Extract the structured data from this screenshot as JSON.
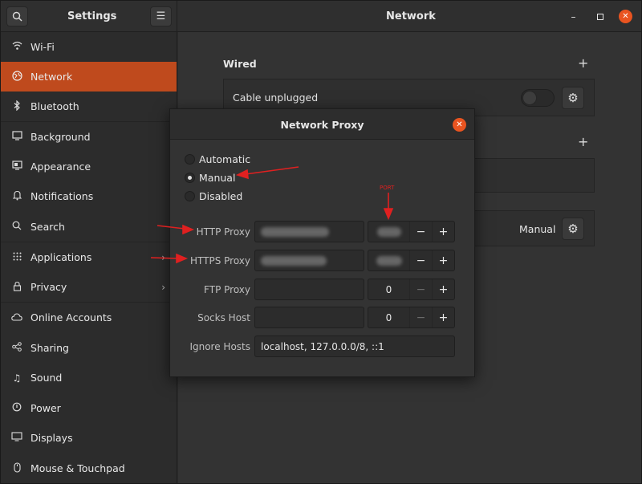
{
  "app": {
    "title": "Settings",
    "page_title": "Network"
  },
  "header": {
    "search_icon": "search-icon",
    "menu_icon": "hamburger-icon"
  },
  "sidebar": {
    "items": [
      {
        "label": "Wi-Fi",
        "icon": "wifi-icon"
      },
      {
        "label": "Network",
        "icon": "network-globe-icon"
      },
      {
        "label": "Bluetooth",
        "icon": "bluetooth-icon"
      },
      {
        "label": "Background",
        "icon": "background-icon"
      },
      {
        "label": "Appearance",
        "icon": "appearance-icon"
      },
      {
        "label": "Notifications",
        "icon": "bell-icon"
      },
      {
        "label": "Search",
        "icon": "search-icon"
      },
      {
        "label": "Applications",
        "icon": "apps-grid-icon"
      },
      {
        "label": "Privacy",
        "icon": "lock-icon"
      },
      {
        "label": "Online Accounts",
        "icon": "cloud-icon"
      },
      {
        "label": "Sharing",
        "icon": "share-icon"
      },
      {
        "label": "Sound",
        "icon": "music-note-icon"
      },
      {
        "label": "Power",
        "icon": "power-icon"
      },
      {
        "label": "Displays",
        "icon": "display-icon"
      },
      {
        "label": "Mouse & Touchpad",
        "icon": "mouse-icon"
      }
    ],
    "active": "Network"
  },
  "main": {
    "wired_title": "Wired",
    "wired_status": "Cable unplugged",
    "proxy_mode": "Manual"
  },
  "dialog": {
    "title": "Network Proxy",
    "options": [
      "Automatic",
      "Manual",
      "Disabled"
    ],
    "selected": "Manual",
    "rows": {
      "http": {
        "label": "HTTP Proxy"
      },
      "https": {
        "label": "HTTPS Proxy"
      },
      "ftp": {
        "label": "FTP Proxy",
        "port": "0"
      },
      "socks": {
        "label": "Socks Host",
        "port": "0"
      }
    },
    "ignore_label": "Ignore Hosts",
    "ignore_value": "localhost, 127.0.0.0/8, ::1"
  },
  "annotations": {
    "port_label": "PORT",
    "arrow_color": "#e02020"
  },
  "colors": {
    "accent": "#bf4a1d",
    "close": "#e95420"
  }
}
